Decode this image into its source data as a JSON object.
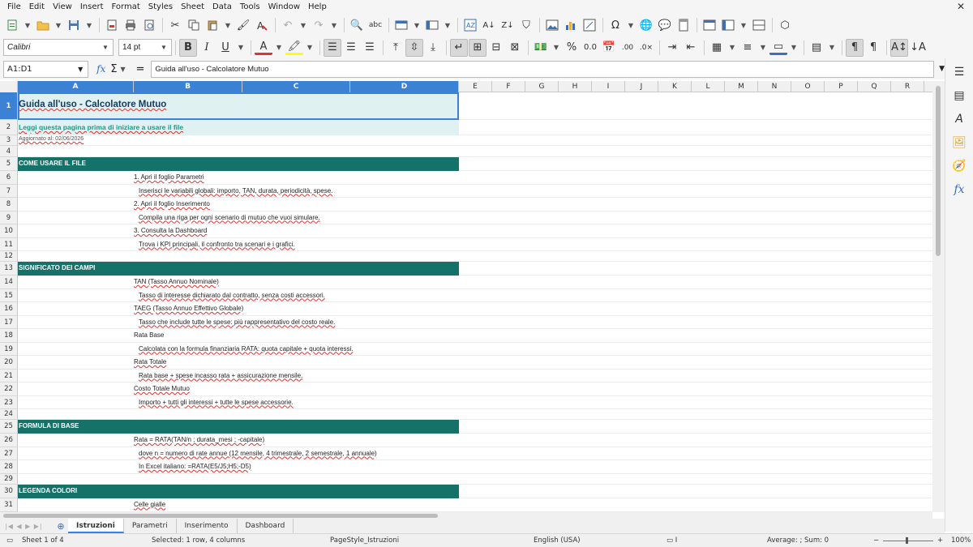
{
  "menu": [
    "File",
    "Edit",
    "View",
    "Insert",
    "Format",
    "Styles",
    "Sheet",
    "Data",
    "Tools",
    "Window",
    "Help"
  ],
  "font": {
    "name": "Calibri",
    "size": "14 pt"
  },
  "formula_bar": {
    "name_box": "A1:D1",
    "content": "Guida all'uso - Calcolatore Mutuo"
  },
  "columns": [
    "A",
    "B",
    "C",
    "D",
    "E",
    "F",
    "G",
    "H",
    "I",
    "J",
    "K",
    "L",
    "M",
    "N",
    "O",
    "P",
    "Q",
    "R"
  ],
  "rows": {
    "r1": "Guida all'uso - Calcolatore Mutuo",
    "r2": "Leggi questa pagina prima di iniziare a usare il file",
    "r3": "Aggiornato al: 02/06/2026",
    "r5": "COME USARE IL FILE",
    "r6": "1. Apri il foglio Parametri",
    "r7": "Inserisci le variabili globali: importo, TAN, durata, periodicità, spese.",
    "r8": "2. Apri il foglio Inserimento",
    "r9": "Compila una riga per ogni scenario di mutuo che vuoi simulare.",
    "r10": "3. Consulta la Dashboard",
    "r11": "Trova i KPI principali, il confronto tra scenari e i grafici.",
    "r13": "SIGNIFICATO DEI CAMPI",
    "r14": "TAN (Tasso Annuo Nominale)",
    "r15": "Tasso di interesse dichiarato dal contratto, senza costi accessori.",
    "r16": "TAEG (Tasso Annuo Effettivo Globale)",
    "r17": "Tasso che include tutte le spese: più rappresentativo del costo reale.",
    "r18": "Rata Base",
    "r19": "Calcolata con la formula finanziaria RATA: quota capitale + quota interessi.",
    "r20": "Rata Totale",
    "r21": "Rata base + spese incasso rata + assicurazione mensile.",
    "r22": "Costo Totale Mutuo",
    "r23": "Importo + tutti gli interessi + tutte le spese accessorie.",
    "r25": "FORMULA DI BASE",
    "r26": "Rata = RATA(TAN/n ; durata_mesi ; -capitale)",
    "r27": "dove n = numero di rate annue (12 mensile, 4 trimestrale, 2 semestrale, 1 annuale)",
    "r28": "In Excel italiano: =RATA(E5/J5;H5;-D5)",
    "r30": "LEGENDA COLORI",
    "r31": "Celle gialle"
  },
  "tabs": [
    "Istruzioni",
    "Parametri",
    "Inserimento",
    "Dashboard"
  ],
  "status": {
    "sheet": "Sheet 1 of 4",
    "selection": "Selected: 1 row, 4 columns",
    "page_style": "PageStyle_Istruzioni",
    "language": "English (USA)",
    "summary": "Average: ; Sum: 0",
    "zoom": "100%"
  },
  "colors": {
    "header_band": "#147268",
    "title_band": "#dff1f1",
    "selection": "#3b82d6"
  }
}
